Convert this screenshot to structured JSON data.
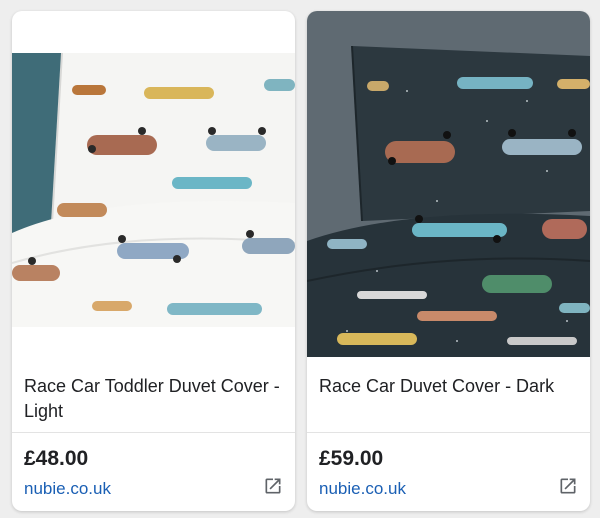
{
  "products": [
    {
      "title": "Race Car Toddler Duvet Cover - Light",
      "price": "£48.00",
      "source": "nubie.co.uk",
      "image_icon": "race-car-duvet-light-image",
      "link_icon": "open-in-new-icon"
    },
    {
      "title": "Race Car Duvet Cover - Dark",
      "price": "£59.00",
      "source": "nubie.co.uk",
      "image_icon": "race-car-duvet-dark-image",
      "link_icon": "open-in-new-icon"
    }
  ],
  "colors": {
    "page_background": "#eeeeee",
    "card_background": "#ffffff",
    "link": "#1a5fb4",
    "text": "#202124",
    "wall_blue": "#3f6c78",
    "duvet_dark": "#27333a"
  }
}
